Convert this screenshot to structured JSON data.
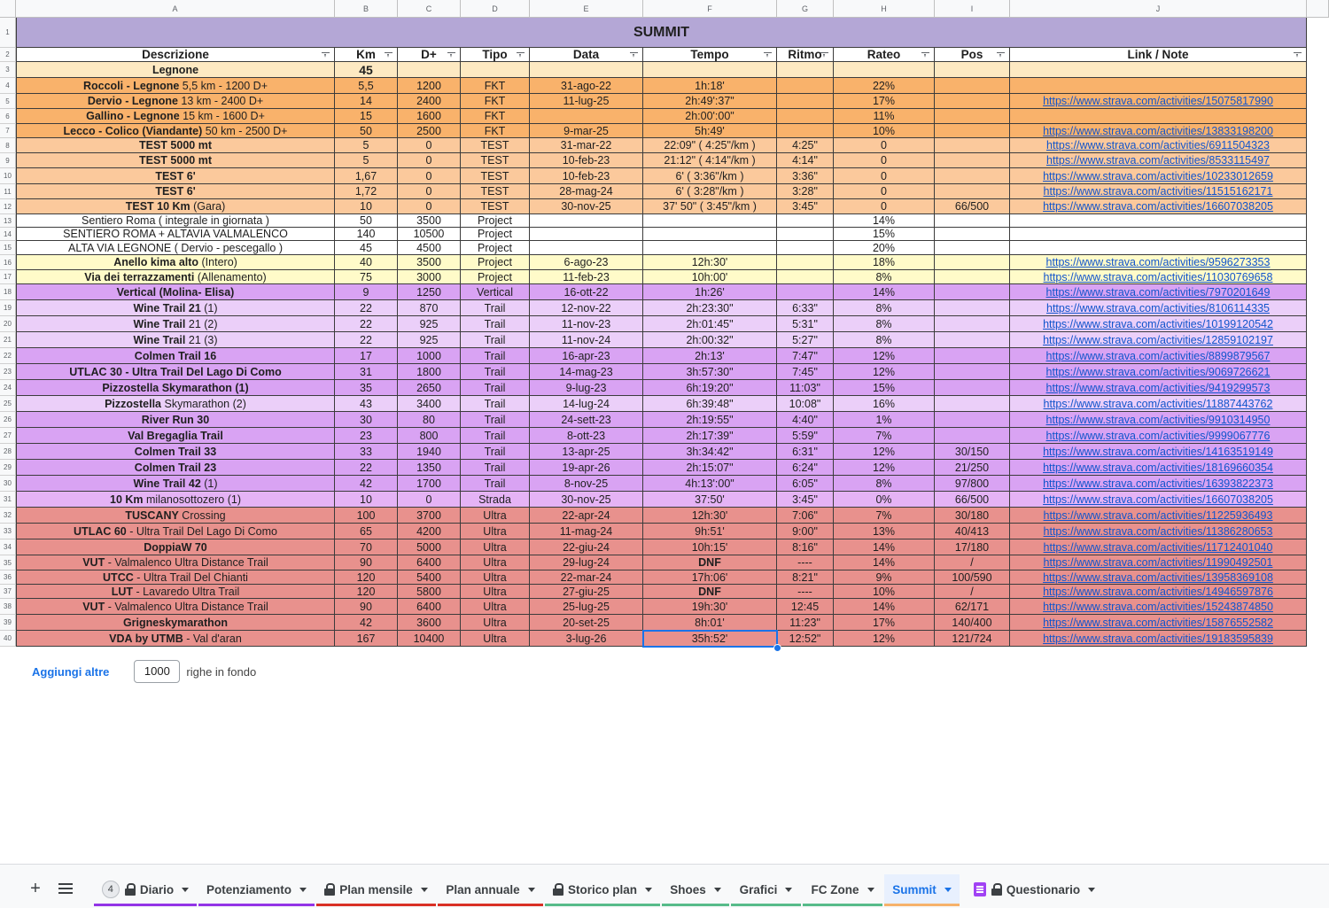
{
  "columns": [
    "A",
    "B",
    "C",
    "D",
    "E",
    "F",
    "G",
    "H",
    "I",
    "J"
  ],
  "title": "SUMMIT",
  "headers": [
    "Descrizione",
    "Km",
    "D+",
    "Tipo",
    "Data",
    "Tempo",
    "Ritmo",
    "Rateo",
    "Pos",
    "Link / Note"
  ],
  "row_numbers": [
    "1",
    "2",
    "3",
    "4",
    "5",
    "6",
    "7",
    "8",
    "9",
    "10",
    "11",
    "12",
    "13",
    "14",
    "15",
    "16",
    "17",
    "18",
    "19",
    "20",
    "21",
    "22",
    "23",
    "24",
    "25",
    "26",
    "27",
    "28",
    "29",
    "30",
    "31",
    "32",
    "33",
    "34",
    "35",
    "36",
    "37",
    "38",
    "39",
    "40"
  ],
  "rows": [
    {
      "bold": "Legnone",
      "rest": "",
      "km": "45",
      "d": "",
      "tipo": "",
      "data": "",
      "tempo": "",
      "ritmo": "",
      "rateo": "",
      "pos": "",
      "link": "",
      "bg": "#fde9c2",
      "desc_bold": true,
      "km_bold": true
    },
    {
      "bold": "Roccoli - Legnone",
      "rest": " 5,5 km - 1200 D+",
      "km": "5,5",
      "d": "1200",
      "tipo": "FKT",
      "data": "31-ago-22",
      "tempo": "1h:18'",
      "ritmo": "",
      "rateo": "22%",
      "pos": "",
      "link": "",
      "bg": "#f9b26b"
    },
    {
      "bold": "Dervio - Legnone",
      "rest": " 13 km - 2400 D+",
      "km": "14",
      "d": "2400",
      "tipo": "FKT",
      "data": "11-lug-25",
      "tempo": "2h:49':37\"",
      "ritmo": "",
      "rateo": "17%",
      "pos": "",
      "link": "https://www.strava.com/activities/15075817990",
      "bg": "#f9b26b"
    },
    {
      "bold": "Gallino - Legnone",
      "rest": " 15 km - 1600 D+",
      "km": "15",
      "d": "1600",
      "tipo": "FKT",
      "data": "",
      "tempo": "2h:00':00\"",
      "ritmo": "",
      "rateo": "11%",
      "pos": "",
      "link": "",
      "bg": "#f9b26b"
    },
    {
      "bold": "Lecco - Colico (Viandante)",
      "rest": " 50 km - 2500 D+",
      "km": "50",
      "d": "2500",
      "tipo": "FKT",
      "data": "9-mar-25",
      "tempo": "5h:49'",
      "ritmo": "",
      "rateo": "10%",
      "pos": "",
      "link": "https://www.strava.com/activities/13833198200",
      "bg": "#f9b26b"
    },
    {
      "bold": "TEST 5000 mt",
      "rest": "",
      "km": "5",
      "d": "0",
      "tipo": "TEST",
      "data": "31-mar-22",
      "tempo": "22:09\" ( 4:25\"/km )",
      "ritmo": "4:25\"",
      "rateo": "0",
      "pos": "",
      "link": "https://www.strava.com/activities/6911504323",
      "bg": "#fbc99c"
    },
    {
      "bold": "TEST 5000 mt",
      "rest": "",
      "km": "5",
      "d": "0",
      "tipo": "TEST",
      "data": "10-feb-23",
      "tempo": "21:12\" ( 4:14\"/km )",
      "ritmo": "4:14\"",
      "rateo": "0",
      "pos": "",
      "link": "https://www.strava.com/activities/8533115497",
      "bg": "#fbc99c"
    },
    {
      "bold": "TEST 6'",
      "rest": "",
      "km": "1,67",
      "d": "0",
      "tipo": "TEST",
      "data": "10-feb-23",
      "tempo": "6' ( 3:36\"/km )",
      "ritmo": "3:36\"",
      "rateo": "0",
      "pos": "",
      "link": "https://www.strava.com/activities/10233012659",
      "bg": "#fbc99c"
    },
    {
      "bold": "TEST 6'",
      "rest": "",
      "km": "1,72",
      "d": "0",
      "tipo": "TEST",
      "data": "28-mag-24",
      "tempo": "6' ( 3:28\"/km )",
      "ritmo": "3:28\"",
      "rateo": "0",
      "pos": "",
      "link": "https://www.strava.com/activities/11515162171",
      "bg": "#fbc99c"
    },
    {
      "bold": "TEST 10 Km",
      "rest": " (Gara)",
      "km": "10",
      "d": "0",
      "tipo": "TEST",
      "data": "30-nov-25",
      "tempo": "37' 50\" ( 3:45\"/km )",
      "ritmo": "3:45\"",
      "rateo": "0",
      "pos": "66/500",
      "link": "https://www.strava.com/activities/16607038205",
      "bg": "#fbc99c"
    },
    {
      "bold": "",
      "rest": "Sentiero Roma ( integrale in giornata )",
      "km": "50",
      "d": "3500",
      "tipo": "Project",
      "data": "",
      "tempo": "",
      "ritmo": "",
      "rateo": "14%",
      "pos": "",
      "link": "",
      "bg": "#ffffff"
    },
    {
      "bold": "",
      "rest": "SENTIERO ROMA + ALTAVIA VALMALENCO",
      "km": "140",
      "d": "10500",
      "tipo": "Project",
      "data": "",
      "tempo": "",
      "ritmo": "",
      "rateo": "15%",
      "pos": "",
      "link": "",
      "bg": "#ffffff"
    },
    {
      "bold": "",
      "rest": "ALTA VIA LEGNONE ( Dervio - pescegallo )",
      "km": "45",
      "d": "4500",
      "tipo": "Project",
      "data": "",
      "tempo": "",
      "ritmo": "",
      "rateo": "20%",
      "pos": "",
      "link": "",
      "bg": "#ffffff"
    },
    {
      "bold": "Anello kima alto",
      "rest": " (Intero)",
      "km": "40",
      "d": "3500",
      "tipo": "Project",
      "data": "6-ago-23",
      "tempo": "12h:30'",
      "ritmo": "",
      "rateo": "18%",
      "pos": "",
      "link": "https://www.strava.com/activities/9596273353",
      "bg": "#fffbc9"
    },
    {
      "bold": "Via dei terrazzamenti",
      "rest": " (Allenamento)",
      "km": "75",
      "d": "3000",
      "tipo": "Project",
      "data": "11-feb-23",
      "tempo": "10h:00'",
      "ritmo": "",
      "rateo": "8%",
      "pos": "",
      "link": "https://www.strava.com/activities/11030769658",
      "bg": "#fffbc9"
    },
    {
      "bold": "Vertical (Molina- Elisa)",
      "rest": "",
      "km": "9",
      "d": "1250",
      "tipo": "Vertical",
      "data": "16-ott-22",
      "tempo": "1h:26'",
      "ritmo": "",
      "rateo": "14%",
      "pos": "",
      "link": "https://www.strava.com/activities/7970201649",
      "bg": "#d9a3f3"
    },
    {
      "bold": "Wine Trail 21",
      "rest": " (1)",
      "km": "22",
      "d": "870",
      "tipo": "Trail",
      "data": "12-nov-22",
      "tempo": "2h:23:30\"",
      "ritmo": "6:33\"",
      "rateo": "8%",
      "pos": "",
      "link": "https://www.strava.com/activities/8106114335",
      "bg": "#ebcff9"
    },
    {
      "bold": "Wine Trail",
      "rest": " 21 (2)",
      "km": "22",
      "d": "925",
      "tipo": "Trail",
      "data": "11-nov-23",
      "tempo": "2h:01:45\"",
      "ritmo": "5:31\"",
      "rateo": "8%",
      "pos": "",
      "link": "https://www.strava.com/activities/10199120542",
      "bg": "#ebcff9"
    },
    {
      "bold": "Wine Trail",
      "rest": " 21 (3)",
      "km": "22",
      "d": "925",
      "tipo": "Trail",
      "data": "11-nov-24",
      "tempo": "2h:00:32\"",
      "ritmo": "5:27\"",
      "rateo": "8%",
      "pos": "",
      "link": "https://www.strava.com/activities/12859102197",
      "bg": "#ebcff9"
    },
    {
      "bold": "Colmen Trail 16",
      "rest": "",
      "km": "17",
      "d": "1000",
      "tipo": "Trail",
      "data": "16-apr-23",
      "tempo": "2h:13'",
      "ritmo": "7:47\"",
      "rateo": "12%",
      "pos": "",
      "link": "https://www.strava.com/activities/8899879567",
      "bg": "#d9a3f3"
    },
    {
      "bold": "UTLAC 30 - Ultra Trail Del Lago Di Como",
      "rest": "",
      "km": "31",
      "d": "1800",
      "tipo": "Trail",
      "data": "14-mag-23",
      "tempo": "3h:57:30\"",
      "ritmo": "7:45\"",
      "rateo": "12%",
      "pos": "",
      "link": "https://www.strava.com/activities/9069726621",
      "bg": "#d9a3f3"
    },
    {
      "bold": "Pizzostella Skymarathon (1)",
      "rest": "",
      "km": "35",
      "d": "2650",
      "tipo": "Trail",
      "data": "9-lug-23",
      "tempo": "6h:19:20\"",
      "ritmo": "11:03\"",
      "rateo": "15%",
      "pos": "",
      "link": "https://www.strava.com/activities/9419299573",
      "bg": "#d9a3f3"
    },
    {
      "bold": "Pizzostella",
      "rest": " Skymarathon (2)",
      "km": "43",
      "d": "3400",
      "tipo": "Trail",
      "data": "14-lug-24",
      "tempo": "6h:39:48\"",
      "ritmo": "10:08\"",
      "rateo": "16%",
      "pos": "",
      "link": "https://www.strava.com/activities/11887443762",
      "bg": "#ebcff9"
    },
    {
      "bold": "River Run 30",
      "rest": "",
      "km": "30",
      "d": "80",
      "tipo": "Trail",
      "data": "24-sett-23",
      "tempo": "2h:19:55\"",
      "ritmo": "4:40\"",
      "rateo": "1%",
      "pos": "",
      "link": "https://www.strava.com/activities/9910314950",
      "bg": "#d9a3f3"
    },
    {
      "bold": "Val Bregaglia Trail",
      "rest": "",
      "km": "23",
      "d": "800",
      "tipo": "Trail",
      "data": "8-ott-23",
      "tempo": "2h:17:39\"",
      "ritmo": "5:59\"",
      "rateo": "7%",
      "pos": "",
      "link": "https://www.strava.com/activities/9999067776",
      "bg": "#d9a3f3"
    },
    {
      "bold": "Colmen Trail 33",
      "rest": "",
      "km": "33",
      "d": "1940",
      "tipo": "Trail",
      "data": "13-apr-25",
      "tempo": "3h:34:42\"",
      "ritmo": "6:31\"",
      "rateo": "12%",
      "pos": "30/150",
      "link": "https://www.strava.com/activities/14163519149",
      "bg": "#d9a3f3"
    },
    {
      "bold": "Colmen Trail 23",
      "rest": "",
      "km": "22",
      "d": "1350",
      "tipo": "Trail",
      "data": "19-apr-26",
      "tempo": "2h:15:07\"",
      "ritmo": "6:24\"",
      "rateo": "12%",
      "pos": "21/250",
      "link": "https://www.strava.com/activities/18169660354",
      "bg": "#d9a3f3"
    },
    {
      "bold": "Wine Trail 42",
      "rest": " (1)",
      "km": "42",
      "d": "1700",
      "tipo": "Trail",
      "data": "8-nov-25",
      "tempo": "4h:13':00\"",
      "ritmo": "6:05\"",
      "rateo": "8%",
      "pos": "97/800",
      "link": "https://www.strava.com/activities/16393822373",
      "bg": "#d9a3f3"
    },
    {
      "bold": "10 Km",
      "rest": " milanosottozero (1)",
      "km": "10",
      "d": "0",
      "tipo": "Strada",
      "data": "30-nov-25",
      "tempo": "37:50'",
      "ritmo": "3:45\"",
      "rateo": "0%",
      "pos": "66/500",
      "link": "https://www.strava.com/activities/16607038205",
      "bg": "#e5b3f5"
    },
    {
      "bold": "TUSCANY",
      "rest": " Crossing",
      "km": "100",
      "d": "3700",
      "tipo": "Ultra",
      "data": "22-apr-24",
      "tempo": "12h:30'",
      "ritmo": "7:06\"",
      "rateo": "7%",
      "pos": "30/180",
      "link": "https://www.strava.com/activities/11225936493",
      "bg": "#e8918d"
    },
    {
      "bold": "UTLAC 60",
      "rest": " - Ultra Trail Del Lago Di Como",
      "km": "65",
      "d": "4200",
      "tipo": "Ultra",
      "data": "11-mag-24",
      "tempo": "9h:51'",
      "ritmo": "9:00\"",
      "rateo": "13%",
      "pos": "40/413",
      "link": "https://www.strava.com/activities/11386280653",
      "bg": "#e8918d"
    },
    {
      "bold": "DoppiaW 70",
      "rest": "",
      "km": "70",
      "d": "5000",
      "tipo": "Ultra",
      "data": "22-giu-24",
      "tempo": "10h:15'",
      "ritmo": "8:16\"",
      "rateo": "14%",
      "pos": "17/180",
      "link": "https://www.strava.com/activities/11712401040",
      "bg": "#e8918d"
    },
    {
      "bold": "VUT",
      "rest": " - Valmalenco Ultra Distance Trail",
      "km": "90",
      "d": "6400",
      "tipo": "Ultra",
      "data": "29-lug-24",
      "tempo": "DNF",
      "ritmo": "----",
      "rateo": "14%",
      "pos": "/",
      "link": "https://www.strava.com/activities/11990492501",
      "bg": "#e8918d",
      "tempo_bold": true
    },
    {
      "bold": "UTCC",
      "rest": " - Ultra Trail Del Chianti",
      "km": "120",
      "d": "5400",
      "tipo": "Ultra",
      "data": "22-mar-24",
      "tempo": "17h:06'",
      "ritmo": "8:21\"",
      "rateo": "9%",
      "pos": "100/590",
      "link": "https://www.strava.com/activities/13958369108",
      "bg": "#e8918d"
    },
    {
      "bold": "LUT",
      "rest": " - Lavaredo Ultra Trail",
      "km": "120",
      "d": "5800",
      "tipo": "Ultra",
      "data": "27-giu-25",
      "tempo": "DNF",
      "ritmo": "----",
      "rateo": "10%",
      "pos": "/",
      "link": "https://www.strava.com/activities/14946597876",
      "bg": "#e8918d",
      "tempo_bold": true
    },
    {
      "bold": "VUT",
      "rest": " - Valmalenco Ultra Distance Trail",
      "km": "90",
      "d": "6400",
      "tipo": "Ultra",
      "data": "25-lug-25",
      "tempo": "19h:30'",
      "ritmo": "12:45",
      "rateo": "14%",
      "pos": "62/171",
      "link": "https://www.strava.com/activities/15243874850",
      "bg": "#e8918d"
    },
    {
      "bold": "Grigneskymarathon",
      "rest": "",
      "km": "42",
      "d": "3600",
      "tipo": "Ultra",
      "data": "20-set-25",
      "tempo": "8h:01'",
      "ritmo": "11:23\"",
      "rateo": "17%",
      "pos": "140/400",
      "link": "https://www.strava.com/activities/15876552582",
      "bg": "#e8918d"
    },
    {
      "bold": "VDA by UTMB",
      "rest": " - Val d'aran",
      "km": "167",
      "d": "10400",
      "tipo": "Ultra",
      "data": "3-lug-26",
      "tempo": "35h:52'",
      "ritmo": "12:52\"",
      "rateo": "12%",
      "pos": "121/724",
      "link": "https://www.strava.com/activities/19183595839",
      "bg": "#e8918d"
    }
  ],
  "colors": {
    "title_bg": "#b4a7d6",
    "header_bg": "#ffffff",
    "accent": "#1a73e8",
    "link": "#1155cc"
  },
  "add_rows": {
    "button": "Aggiungi altre",
    "value": "1000",
    "suffix": "righe in fondo"
  },
  "tabs": [
    {
      "label": "Diario",
      "badge": "4",
      "lock": true,
      "color": "#9334e6",
      "active": false
    },
    {
      "label": "Potenziamento",
      "lock": false,
      "color": "#9334e6",
      "active": false
    },
    {
      "label": "Plan mensile",
      "lock": true,
      "color": "#d93025",
      "active": false
    },
    {
      "label": "Plan annuale",
      "lock": false,
      "color": "#d93025",
      "active": false
    },
    {
      "label": "Storico plan",
      "lock": true,
      "color": "#57bb8a",
      "active": false
    },
    {
      "label": "Shoes",
      "lock": false,
      "color": "#57bb8a",
      "active": false
    },
    {
      "label": "Grafici",
      "lock": false,
      "color": "#57bb8a",
      "active": false
    },
    {
      "label": "FC Zone",
      "lock": false,
      "color": "#57bb8a",
      "active": false
    },
    {
      "label": "Summit",
      "lock": false,
      "color": "#f6b26b",
      "active": true
    },
    {
      "label": "Questionario",
      "lock": true,
      "form": true,
      "color": "",
      "active": false
    }
  ]
}
